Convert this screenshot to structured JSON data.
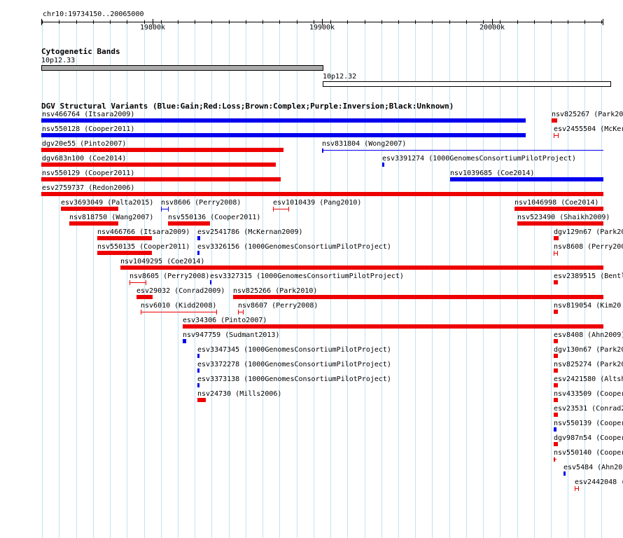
{
  "ruler": {
    "region": "chr10:19734150..20065000",
    "ticks": [
      "19800k",
      "19900k",
      "20000k"
    ]
  },
  "cytoband": {
    "title": "Cytogenetic Bands",
    "bands": [
      {
        "name": "10p12.33",
        "color": "#aaaaaa"
      },
      {
        "name": "10p12.32",
        "color": "#ffffff"
      }
    ]
  },
  "dgv": {
    "title": "DGV Structural Variants (Blue:Gain;Red:Loss;Brown:Complex;Purple:Inversion;Black:Unknown)",
    "colors": {
      "blue": "#0000ee",
      "red": "#ee0000"
    },
    "features": [
      {
        "label": "nsv466764 (Itsara2009)",
        "color": "blue"
      },
      {
        "label": "nsv825267 (Park20",
        "color": "red"
      },
      {
        "label": "nsv550128 (Cooper2011)",
        "color": "blue"
      },
      {
        "label": "esv2455504 (McKer",
        "color": "red"
      },
      {
        "label": "dgv20e55 (Pinto2007)",
        "color": "red"
      },
      {
        "label": "nsv831804 (Wong2007)",
        "color": "blue"
      },
      {
        "label": "dgv683n100 (Coe2014)",
        "color": "red"
      },
      {
        "label": "esv3391274 (1000GenomesConsortiumPilotProject)",
        "color": "blue"
      },
      {
        "label": "nsv550129 (Cooper2011)",
        "color": "red"
      },
      {
        "label": "nsv1039685 (Coe2014)",
        "color": "blue"
      },
      {
        "label": "esv2759737 (Redon2006)",
        "color": "red"
      },
      {
        "label": "esv3693049 (Palta2015)",
        "color": "red"
      },
      {
        "label": "nsv8606 (Perry2008)",
        "color": "blue"
      },
      {
        "label": "esv1010439 (Pang2010)",
        "color": "red"
      },
      {
        "label": "nsv1046998 (Coe2014)",
        "color": "red"
      },
      {
        "label": "nsv818750 (Wang2007)",
        "color": "red"
      },
      {
        "label": "nsv550136 (Cooper2011)",
        "color": "red"
      },
      {
        "label": "nsv523490 (Shaikh2009)",
        "color": "red"
      },
      {
        "label": "nsv466766 (Itsara2009)",
        "color": "red"
      },
      {
        "label": "esv2541786 (McKernan2009)",
        "color": "blue"
      },
      {
        "label": "dgv129n67 (Park20",
        "color": "red"
      },
      {
        "label": "nsv550135 (Cooper2011)",
        "color": "red"
      },
      {
        "label": "esv3326156 (1000GenomesConsortiumPilotProject)",
        "color": "blue"
      },
      {
        "label": "nsv8608 (Perry200",
        "color": "red"
      },
      {
        "label": "nsv1049295 (Coe2014)",
        "color": "red"
      },
      {
        "label": "nsv8605 (Perry2008)",
        "color": "red"
      },
      {
        "label": "esv3327315 (1000GenomesConsortiumPilotProject)",
        "color": "blue"
      },
      {
        "label": "esv2389515 (Bentl",
        "color": "red"
      },
      {
        "label": "esv29032 (Conrad2009)",
        "color": "red"
      },
      {
        "label": "nsv825266 (Park2010)",
        "color": "red"
      },
      {
        "label": "nsv6010 (Kidd2008)",
        "color": "red"
      },
      {
        "label": "nsv8607 (Perry2008)",
        "color": "red"
      },
      {
        "label": "nsv819054 (Kim20",
        "color": "red"
      },
      {
        "label": "esv34306 (Pinto2007)",
        "color": "red"
      },
      {
        "label": "nsv947759 (Sudmant2013)",
        "color": "blue"
      },
      {
        "label": "esv8408 (Ahn2009)",
        "color": "red"
      },
      {
        "label": "esv3347345 (1000GenomesConsortiumPilotProject)",
        "color": "blue"
      },
      {
        "label": "dgv130n67 (Park20",
        "color": "red"
      },
      {
        "label": "esv3372278 (1000GenomesConsortiumPilotProject)",
        "color": "blue"
      },
      {
        "label": "nsv825274 (Park20",
        "color": "red"
      },
      {
        "label": "esv3373138 (1000GenomesConsortiumPilotProject)",
        "color": "blue"
      },
      {
        "label": "esv2421580 (Altsh",
        "color": "red"
      },
      {
        "label": "nsv24730 (Mills2006)",
        "color": "red"
      },
      {
        "label": "nsv433509 (Cooper",
        "color": "red"
      },
      {
        "label": "esv23531 (Conrad2",
        "color": "red"
      },
      {
        "label": "nsv550139 (Cooper",
        "color": "blue"
      },
      {
        "label": "dgv987n54 (Cooper",
        "color": "red"
      },
      {
        "label": "nsv550140 (Cooper",
        "color": "red"
      },
      {
        "label": "esv5484 (Ahn20",
        "color": "blue"
      },
      {
        "label": "esv2442048 (",
        "color": "red"
      }
    ]
  }
}
